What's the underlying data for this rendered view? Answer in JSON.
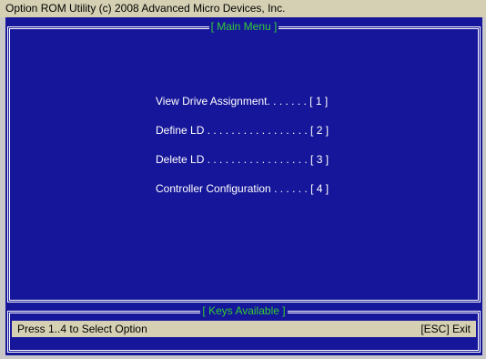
{
  "window": {
    "title": "Option ROM Utility (c) 2008 Advanced Micro Devices, Inc."
  },
  "main_menu": {
    "title": "[ Main Menu ]",
    "items": [
      {
        "label": "View Drive Assignment. . . . . . . [ 1 ]"
      },
      {
        "label": "Define LD . . . . . . . . . . . . . . . . . [ 2 ]"
      },
      {
        "label": "Delete LD . . . . . . . . . . . . . . . . . [ 3 ]"
      },
      {
        "label": "Controller Configuration . . . . . . [ 4 ]"
      }
    ]
  },
  "keys_panel": {
    "title": "[ Keys Available ]",
    "hint": "Press 1..4 to Select Option",
    "exit": "[ESC] Exit"
  },
  "colors": {
    "screen_background": "#16169a",
    "bar_background": "#d5d0b3",
    "frame_title": "#33cc33",
    "text": "#ffffff"
  }
}
